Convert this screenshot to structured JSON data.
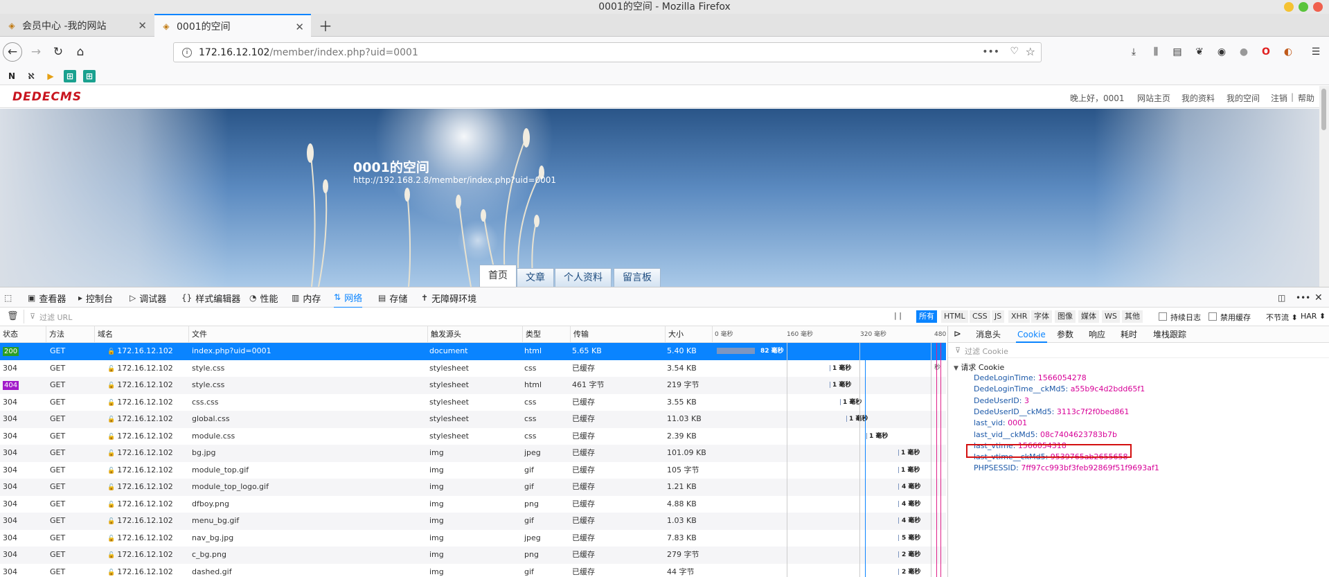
{
  "window": {
    "title": "0001的空间 - Mozilla Firefox"
  },
  "tabs": [
    {
      "title": "会员中心 -我的网站"
    },
    {
      "title": "0001的空间"
    }
  ],
  "address": {
    "host": "172.16.12.102",
    "path": "/member/index.php?uid=0001"
  },
  "site": {
    "logo": "DEDECMS",
    "toplinks": [
      "晚上好，0001",
      "网站主页",
      "我的资料",
      "我的空间",
      "注销",
      "帮助"
    ],
    "space_title": "0001的空间",
    "space_url": "http://192.168.2.8/member/index.php?uid=0001",
    "page_tabs": [
      "首页",
      "文章",
      "个人资料",
      "留言板"
    ]
  },
  "devtools": {
    "tools": [
      "查看器",
      "控制台",
      "调试器",
      "样式编辑器",
      "性能",
      "内存",
      "网络",
      "存储",
      "无障碍环境"
    ],
    "filter_placeholder": "过滤 URL",
    "pause": "| |",
    "type_filters": [
      "所有",
      "HTML",
      "CSS",
      "JS",
      "XHR",
      "字体",
      "图像",
      "媒体",
      "WS",
      "其他"
    ],
    "persist_log": "持续日志",
    "disable_cache": "禁用缓存",
    "throttle": "不节流 ⬍",
    "har": "HAR ⬍",
    "columns": [
      "状态",
      "方法",
      "域名",
      "文件",
      "触发源头",
      "类型",
      "传输",
      "大小"
    ],
    "waterfall_ticks": [
      "0 毫秒",
      "160 毫秒",
      "320 毫秒",
      "480 毫秒"
    ],
    "requests": [
      {
        "status": "200",
        "method": "GET",
        "domain": "172.16.12.102",
        "file": "index.php?uid=0001",
        "cause": "document",
        "type": "html",
        "transfer": "5.65 KB",
        "size": "5.40 KB",
        "timing": "82 毫秒"
      },
      {
        "status": "304",
        "method": "GET",
        "domain": "172.16.12.102",
        "file": "style.css",
        "cause": "stylesheet",
        "type": "css",
        "transfer": "已缓存",
        "size": "3.54 KB",
        "timing": "1 毫秒"
      },
      {
        "status": "404",
        "method": "GET",
        "domain": "172.16.12.102",
        "file": "style.css",
        "cause": "stylesheet",
        "type": "html",
        "transfer": "461 字节",
        "size": "219 字节",
        "timing": "1 毫秒"
      },
      {
        "status": "304",
        "method": "GET",
        "domain": "172.16.12.102",
        "file": "css.css",
        "cause": "stylesheet",
        "type": "css",
        "transfer": "已缓存",
        "size": "3.55 KB",
        "timing": "1 毫秒"
      },
      {
        "status": "304",
        "method": "GET",
        "domain": "172.16.12.102",
        "file": "global.css",
        "cause": "stylesheet",
        "type": "css",
        "transfer": "已缓存",
        "size": "11.03 KB",
        "timing": "1 毫秒"
      },
      {
        "status": "304",
        "method": "GET",
        "domain": "172.16.12.102",
        "file": "module.css",
        "cause": "stylesheet",
        "type": "css",
        "transfer": "已缓存",
        "size": "2.39 KB",
        "timing": "1 毫秒"
      },
      {
        "status": "304",
        "method": "GET",
        "domain": "172.16.12.102",
        "file": "bg.jpg",
        "cause": "img",
        "type": "jpeg",
        "transfer": "已缓存",
        "size": "101.09 KB",
        "timing": "1 毫秒"
      },
      {
        "status": "304",
        "method": "GET",
        "domain": "172.16.12.102",
        "file": "module_top.gif",
        "cause": "img",
        "type": "gif",
        "transfer": "已缓存",
        "size": "105 字节",
        "timing": "1 毫秒"
      },
      {
        "status": "304",
        "method": "GET",
        "domain": "172.16.12.102",
        "file": "module_top_logo.gif",
        "cause": "img",
        "type": "gif",
        "transfer": "已缓存",
        "size": "1.21 KB",
        "timing": "4 毫秒"
      },
      {
        "status": "304",
        "method": "GET",
        "domain": "172.16.12.102",
        "file": "dfboy.png",
        "cause": "img",
        "type": "png",
        "transfer": "已缓存",
        "size": "4.88 KB",
        "timing": "4 毫秒"
      },
      {
        "status": "304",
        "method": "GET",
        "domain": "172.16.12.102",
        "file": "menu_bg.gif",
        "cause": "img",
        "type": "gif",
        "transfer": "已缓存",
        "size": "1.03 KB",
        "timing": "4 毫秒"
      },
      {
        "status": "304",
        "method": "GET",
        "domain": "172.16.12.102",
        "file": "nav_bg.jpg",
        "cause": "img",
        "type": "jpeg",
        "transfer": "已缓存",
        "size": "7.83 KB",
        "timing": "5 毫秒"
      },
      {
        "status": "304",
        "method": "GET",
        "domain": "172.16.12.102",
        "file": "c_bg.png",
        "cause": "img",
        "type": "png",
        "transfer": "已缓存",
        "size": "279 字节",
        "timing": "2 毫秒"
      },
      {
        "status": "304",
        "method": "GET",
        "domain": "172.16.12.102",
        "file": "dashed.gif",
        "cause": "img",
        "type": "gif",
        "transfer": "已缓存",
        "size": "44 字节",
        "timing": "2 毫秒"
      }
    ],
    "detail_tabs": [
      "消息头",
      "Cookie",
      "参数",
      "响应",
      "耗时",
      "堆栈跟踪"
    ],
    "cookie_filter_placeholder": "过滤 Cookie",
    "cookie_section": "请求 Cookie",
    "cookies": [
      {
        "key": "DedeLoginTime",
        "value": "1566054278"
      },
      {
        "key": "DedeLoginTime__ckMd5",
        "value": "a55b9c4d2bdd65f1"
      },
      {
        "key": "DedeUserID",
        "value": "3"
      },
      {
        "key": "DedeUserID__ckMd5",
        "value": "3113c7f2f0bed861"
      },
      {
        "key": "last_vid",
        "value": "0001"
      },
      {
        "key": "last_vid__ckMd5",
        "value": "08c7404623783b7b"
      },
      {
        "key": "last_vtime",
        "value": "1566054318"
      },
      {
        "key": "last_vtime__ckMd5",
        "value": "9539765ab2655658"
      },
      {
        "key": "PHPSESSID",
        "value": "7ff97cc993bf3feb92869f51f9693af1"
      }
    ]
  },
  "colors": {
    "accent": "#0a84ff",
    "status_ok": "#2c9e26",
    "status_404": "#a11ac9",
    "highlight_box": "#d30f0f"
  }
}
